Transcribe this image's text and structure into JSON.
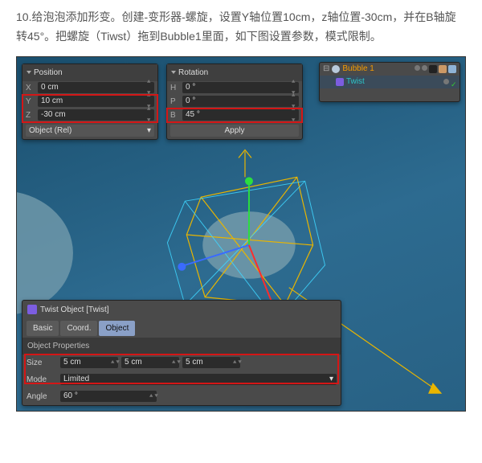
{
  "instruction_text": "10.给泡泡添加形变。创建-变形器-螺旋，设置Y轴位置10cm，z轴位置-30cm，并在B轴旋转45°。把螺旋（Tiwst）拖到Bubble1里面，如下图设置参数，模式限制。",
  "position": {
    "title": "Position",
    "x_label": "X",
    "x_value": "0 cm",
    "y_label": "Y",
    "y_value": "10 cm",
    "z_label": "Z",
    "z_value": "-30 cm",
    "frame": "Object (Rel)"
  },
  "rotation": {
    "title": "Rotation",
    "h_label": "H",
    "h_value": "0 °",
    "p_label": "P",
    "p_value": "0 °",
    "b_label": "B",
    "b_value": "45 °",
    "apply": "Apply"
  },
  "om": {
    "tree": [
      {
        "name": "Bubble 1",
        "color": "#f59b00"
      },
      {
        "name": "Twist",
        "color": "#2cc4c8"
      }
    ]
  },
  "twist": {
    "header": "Twist Object [Twist]",
    "tabs": [
      "Basic",
      "Coord.",
      "Object"
    ],
    "section": "Object Properties",
    "size_label": "Size",
    "size": [
      "5 cm",
      "5 cm",
      "5 cm"
    ],
    "mode_label": "Mode",
    "mode_value": "Limited",
    "angle_label": "Angle",
    "angle_value": "60 °"
  }
}
